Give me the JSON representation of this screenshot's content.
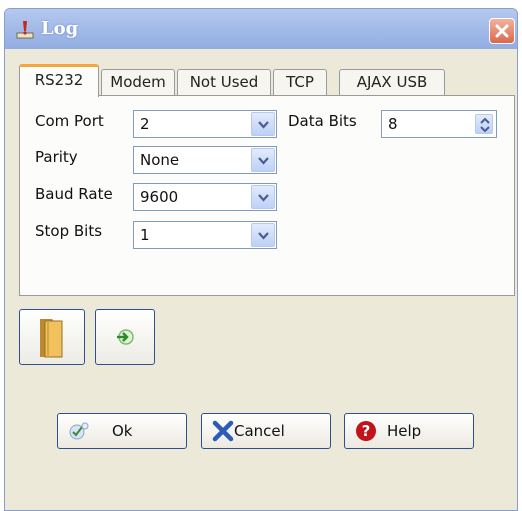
{
  "window": {
    "title": "Log",
    "title_icon": "red-exclamation-icon",
    "close_icon": "close-icon"
  },
  "tabs": [
    {
      "label": "RS232",
      "active": true
    },
    {
      "label": "Modem",
      "active": false
    },
    {
      "label": "Not Used",
      "active": false
    },
    {
      "label": "TCP",
      "active": false
    },
    {
      "label": "AJAX USB",
      "active": false
    }
  ],
  "rs232": {
    "com_port": {
      "label": "Com Port",
      "value": "2"
    },
    "parity": {
      "label": "Parity",
      "value": "None"
    },
    "baud_rate": {
      "label": "Baud Rate",
      "value": "9600"
    },
    "stop_bits": {
      "label": "Stop Bits",
      "value": "1"
    },
    "data_bits": {
      "label": "Data Bits",
      "value": "8"
    }
  },
  "toolbar": {
    "folder_icon": "folder-icon",
    "import_icon": "enter-arrow-icon"
  },
  "buttons": {
    "ok": "Ok",
    "cancel": "Cancel",
    "help": "Help"
  },
  "colors": {
    "titlebar": "#a6bde9",
    "active_tab_accent": "#f4a73c",
    "dialog_background": "#ece9d8",
    "close_button": "#d8684c"
  }
}
